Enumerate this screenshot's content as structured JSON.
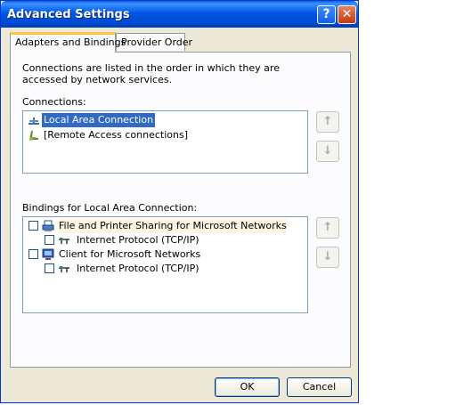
{
  "window": {
    "title": "Advanced Settings",
    "help_label": "?",
    "close_label": "✕"
  },
  "tabs": [
    {
      "label": "Adapters and Bindings",
      "active": true
    },
    {
      "label": "Provider Order",
      "active": false
    }
  ],
  "description": "Connections are listed in the order in which they are accessed by network services.",
  "connections": {
    "label": "Connections:",
    "items": [
      {
        "label": "Local Area Connection",
        "icon": "network-connection-icon",
        "selected": true
      },
      {
        "label": "[Remote Access connections]",
        "icon": "remote-access-icon",
        "selected": false
      }
    ],
    "up_icon": "↑",
    "down_icon": "↓"
  },
  "bindings": {
    "label": "Bindings for Local Area Connection:",
    "items": [
      {
        "label": "File and Printer Sharing for Microsoft Networks",
        "icon": "file-printer-sharing-icon",
        "checked": false,
        "level": 0,
        "highlighted": true
      },
      {
        "label": "Internet Protocol (TCP/IP)",
        "icon": "protocol-icon",
        "checked": false,
        "level": 1
      },
      {
        "label": "Client for Microsoft Networks",
        "icon": "client-icon",
        "checked": false,
        "level": 0
      },
      {
        "label": "Internet Protocol (TCP/IP)",
        "icon": "protocol-icon",
        "checked": false,
        "level": 1
      }
    ],
    "up_icon": "↑",
    "down_icon": "↓"
  },
  "buttons": {
    "ok": "OK",
    "cancel": "Cancel"
  },
  "colors": {
    "title_bar": "#0054e3",
    "selection": "#316ac5",
    "dialog_bg": "#ece9d8"
  }
}
